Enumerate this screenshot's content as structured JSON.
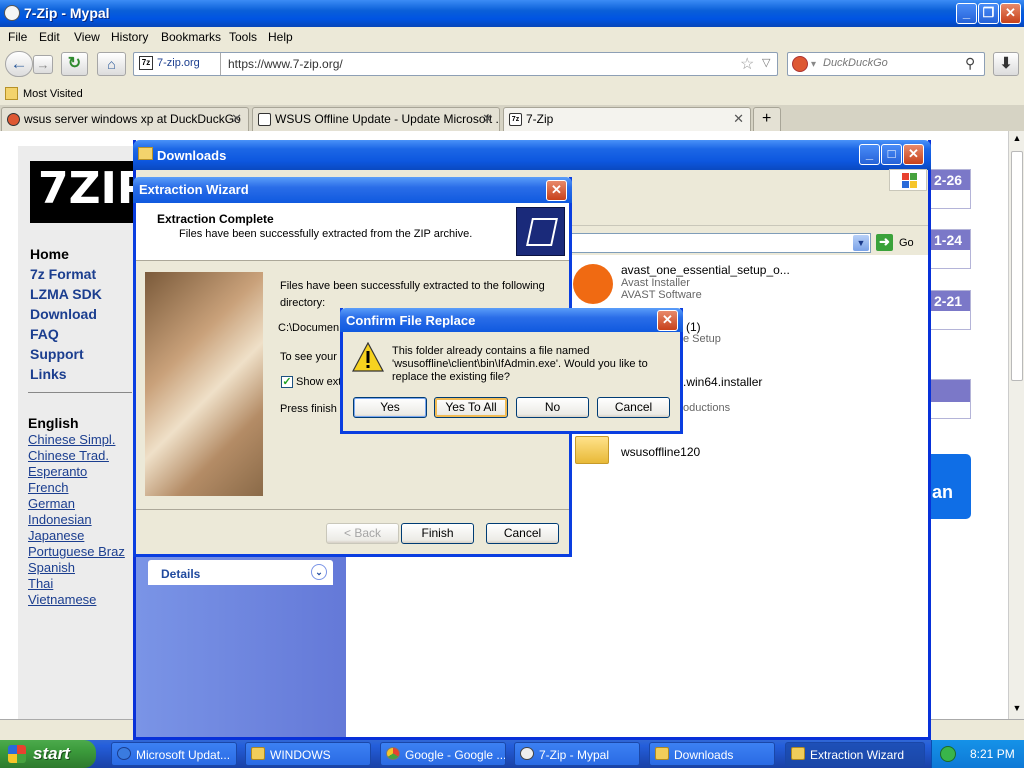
{
  "browser": {
    "title": "7-Zip - Mypal",
    "menus": [
      "File",
      "Edit",
      "View",
      "History",
      "Bookmarks",
      "Tools",
      "Help"
    ],
    "site_badge": "7-zip.org",
    "url": "https://www.7-zip.org/",
    "search_placeholder": "DuckDuckGo",
    "bookmark": "Most Visited",
    "tabs": [
      {
        "label": "wsus server windows xp at DuckDuckGo"
      },
      {
        "label": "WSUS Offline Update - Update Microsoft ..."
      },
      {
        "label": "7-Zip"
      }
    ]
  },
  "page": {
    "logo": "7ZIP",
    "nav": [
      "Home",
      "7z Format",
      "LZMA SDK",
      "Download",
      "FAQ",
      "Support",
      "Links"
    ],
    "lang_heading": "English",
    "languages": [
      "Chinese Simpl.",
      "Chinese Trad.",
      "Esperanto",
      "French",
      "German",
      "Indonesian",
      "Japanese",
      "Portuguese Braz",
      "Spanish",
      "Thai",
      "Vietnamese"
    ],
    "dates": [
      "2-26",
      "1-24",
      "2-21"
    ],
    "banner_text": "an"
  },
  "downloads": {
    "title": "Downloads",
    "go": "Go",
    "details": "Details",
    "files": [
      {
        "name": "avast_one_essential_setup_o...",
        "line2": "Avast Installer",
        "line3": "AVAST Software"
      },
      {
        "name": "(1)",
        "line2": "e Setup",
        "line3": ""
      },
      {
        "name": ".win64.installer",
        "line2": "",
        "line3": "oductions"
      },
      {
        "name": "wsusoffline120",
        "line2": "",
        "line3": ""
      }
    ]
  },
  "wizard": {
    "title": "Extraction Wizard",
    "heading": "Extraction Complete",
    "subheading": "Files have been successfully extracted from the ZIP archive.",
    "body1a": "Files have been successfully extracted to the following",
    "body1b": "directory:",
    "path": "C:\\Documen",
    "body2": "To see your",
    "checkbox": "Show ext",
    "body3": "Press finish t",
    "back": "< Back",
    "finish": "Finish",
    "cancel": "Cancel"
  },
  "confirm": {
    "title": "Confirm File Replace",
    "line1": "This folder already contains a file named",
    "line2": "'wsusoffline\\client\\bin\\IfAdmin.exe'.  Would you like to",
    "line3": "replace the existing file?",
    "yes": "Yes",
    "yes_all": "Yes To All",
    "no": "No",
    "cancel": "Cancel"
  },
  "taskbar": {
    "start": "start",
    "items": [
      "Microsoft Updat...",
      "WINDOWS",
      "Google - Google ...",
      "7-Zip - Mypal",
      "Downloads",
      "Extraction Wizard"
    ],
    "clock": "8:21 PM"
  }
}
